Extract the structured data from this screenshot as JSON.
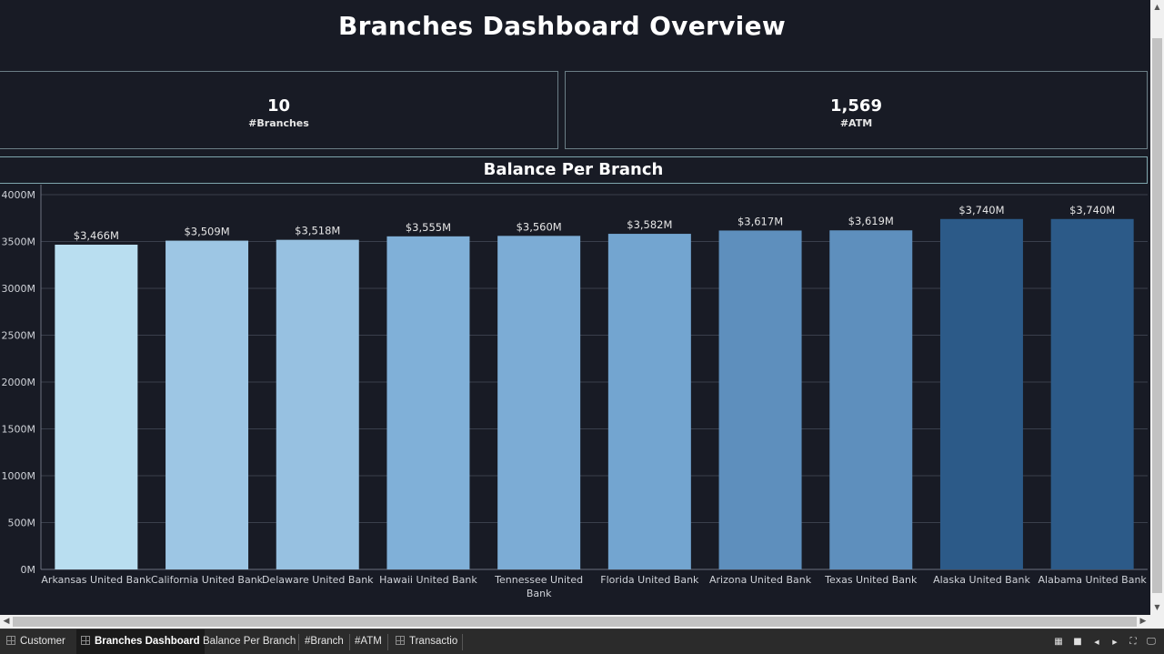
{
  "dashboard": {
    "title": "Branches Dashboard Overview",
    "kpis": [
      {
        "value": "10",
        "label": "#Branches"
      },
      {
        "value": "1,569",
        "label": "#ATM"
      }
    ],
    "chart_title": "Balance Per Branch"
  },
  "chart_data": {
    "type": "bar",
    "title": "Balance Per Branch",
    "xlabel": "",
    "ylabel": "",
    "ylim": [
      0,
      4000
    ],
    "y_ticks": [
      {
        "value": 0,
        "label": "0M"
      },
      {
        "value": 500,
        "label": "500M"
      },
      {
        "value": 1000,
        "label": "1000M"
      },
      {
        "value": 1500,
        "label": "1500M"
      },
      {
        "value": 2000,
        "label": "2000M"
      },
      {
        "value": 2500,
        "label": "2500M"
      },
      {
        "value": 3000,
        "label": "3000M"
      },
      {
        "value": 3500,
        "label": "3500M"
      },
      {
        "value": 4000,
        "label": "4000M"
      }
    ],
    "grid": true,
    "legend": "none",
    "categories": [
      [
        "Arkansas United Bank"
      ],
      [
        "California United Bank"
      ],
      [
        "Delaware United Bank"
      ],
      [
        "Hawaii United Bank"
      ],
      [
        "Tennessee United",
        "Bank"
      ],
      [
        "Florida United Bank"
      ],
      [
        "Arizona United Bank"
      ],
      [
        "Texas United Bank"
      ],
      [
        "Alaska United Bank"
      ],
      [
        "Alabama United Bank"
      ]
    ],
    "values": [
      3466,
      3509,
      3518,
      3555,
      3560,
      3582,
      3617,
      3619,
      3740,
      3740
    ],
    "data_labels": [
      "$3,466M",
      "$3,509M",
      "$3,518M",
      "$3,555M",
      "$3,560M",
      "$3,582M",
      "$3,617M",
      "$3,619M",
      "$3,740M",
      "$3,740M"
    ],
    "colors": [
      "#b9def0",
      "#9dc6e4",
      "#97c1e1",
      "#80b0d8",
      "#7cacd5",
      "#73a5d0",
      "#5e8fbd",
      "#5e8fbd",
      "#2c5a88",
      "#2c5a88"
    ],
    "colors_style": {
      "background": "#181b25",
      "gridline": "#3a3f4c",
      "axis": "#6b7080",
      "tick_text": "#cfd2d8",
      "data_label": "#e6e6e6"
    }
  },
  "tabs": [
    {
      "label": "Customer",
      "icon": "dashboard-grid-icon",
      "active": false
    },
    {
      "label": "Branches Dashboard",
      "icon": "dashboard-grid-icon",
      "active": true
    },
    {
      "label": "Balance Per Branch",
      "icon": "",
      "active": false
    },
    {
      "label": "#Branch",
      "icon": "",
      "active": false
    },
    {
      "label": "#ATM",
      "icon": "",
      "active": false
    },
    {
      "label": "Transactio",
      "icon": "dashboard-grid-icon",
      "active": false
    }
  ],
  "controls": {
    "grid_view_icon": "▦",
    "single_view_icon": "■",
    "prev_icon": "◀",
    "next_icon": "▶",
    "fullscreen_icon": "⛶",
    "present_icon": "🖵"
  }
}
